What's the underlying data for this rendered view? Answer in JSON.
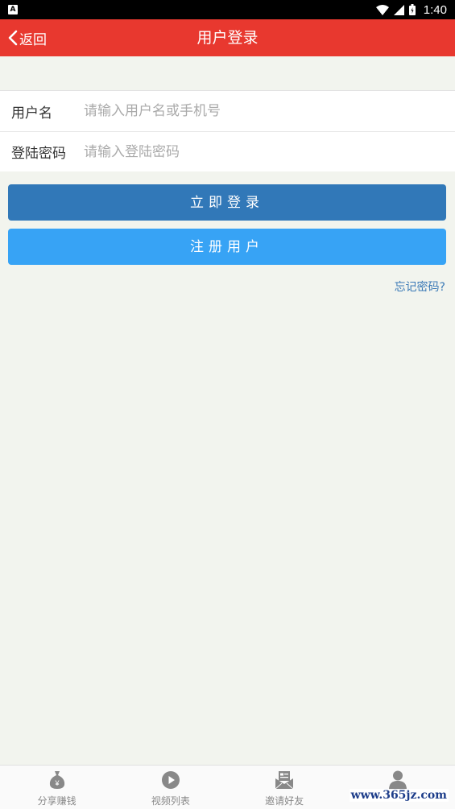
{
  "status_bar": {
    "notification_letter": "A",
    "time": "1:40"
  },
  "header": {
    "back_label": "返回",
    "title": "用户登录"
  },
  "form": {
    "username": {
      "label": "用户名",
      "value": "",
      "placeholder": "请输入用户名或手机号"
    },
    "password": {
      "label": "登陆密码",
      "value": "",
      "placeholder": "请输入登陆密码"
    }
  },
  "actions": {
    "login_label": "立即登录",
    "register_label": "注册用户",
    "forgot_label": "忘记密码?"
  },
  "tabs": [
    {
      "label": "分享赚钱",
      "icon": "money-bag-icon"
    },
    {
      "label": "视频列表",
      "icon": "play-circle-icon"
    },
    {
      "label": "邀请好友",
      "icon": "invite-envelope-icon"
    },
    {
      "label": "",
      "icon": "user-icon"
    }
  ],
  "watermark": "www.365jz.com",
  "colors": {
    "header": "#e8382f",
    "login_button": "#3178b8",
    "register_button": "#37a3f5",
    "link": "#3a79b6",
    "background": "#f2f4ee"
  }
}
